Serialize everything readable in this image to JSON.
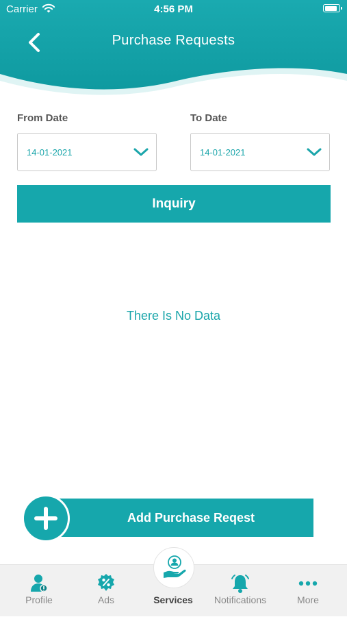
{
  "status_bar": {
    "carrier": "Carrier",
    "time": "4:56 PM"
  },
  "header": {
    "title": "Purchase Requests"
  },
  "filters": {
    "from_label": "From Date",
    "from_value": "14-01-2021",
    "to_label": "To Date",
    "to_value": "14-01-2021"
  },
  "inquiry_label": "Inquiry",
  "empty_message": "There Is No Data",
  "add_label": "Add Purchase Reqest",
  "tabs": [
    {
      "label": "Profile",
      "icon": "profile-icon"
    },
    {
      "label": "Ads",
      "icon": "percent-badge-icon"
    },
    {
      "label": "Services",
      "icon": "services-icon",
      "active": true
    },
    {
      "label": "Notifications",
      "icon": "bell-icon"
    },
    {
      "label": "More",
      "icon": "more-dots-icon"
    }
  ],
  "colors": {
    "accent": "#16a7ac",
    "header": "#1aa9ae",
    "tab_bg": "#f1f1f1"
  }
}
